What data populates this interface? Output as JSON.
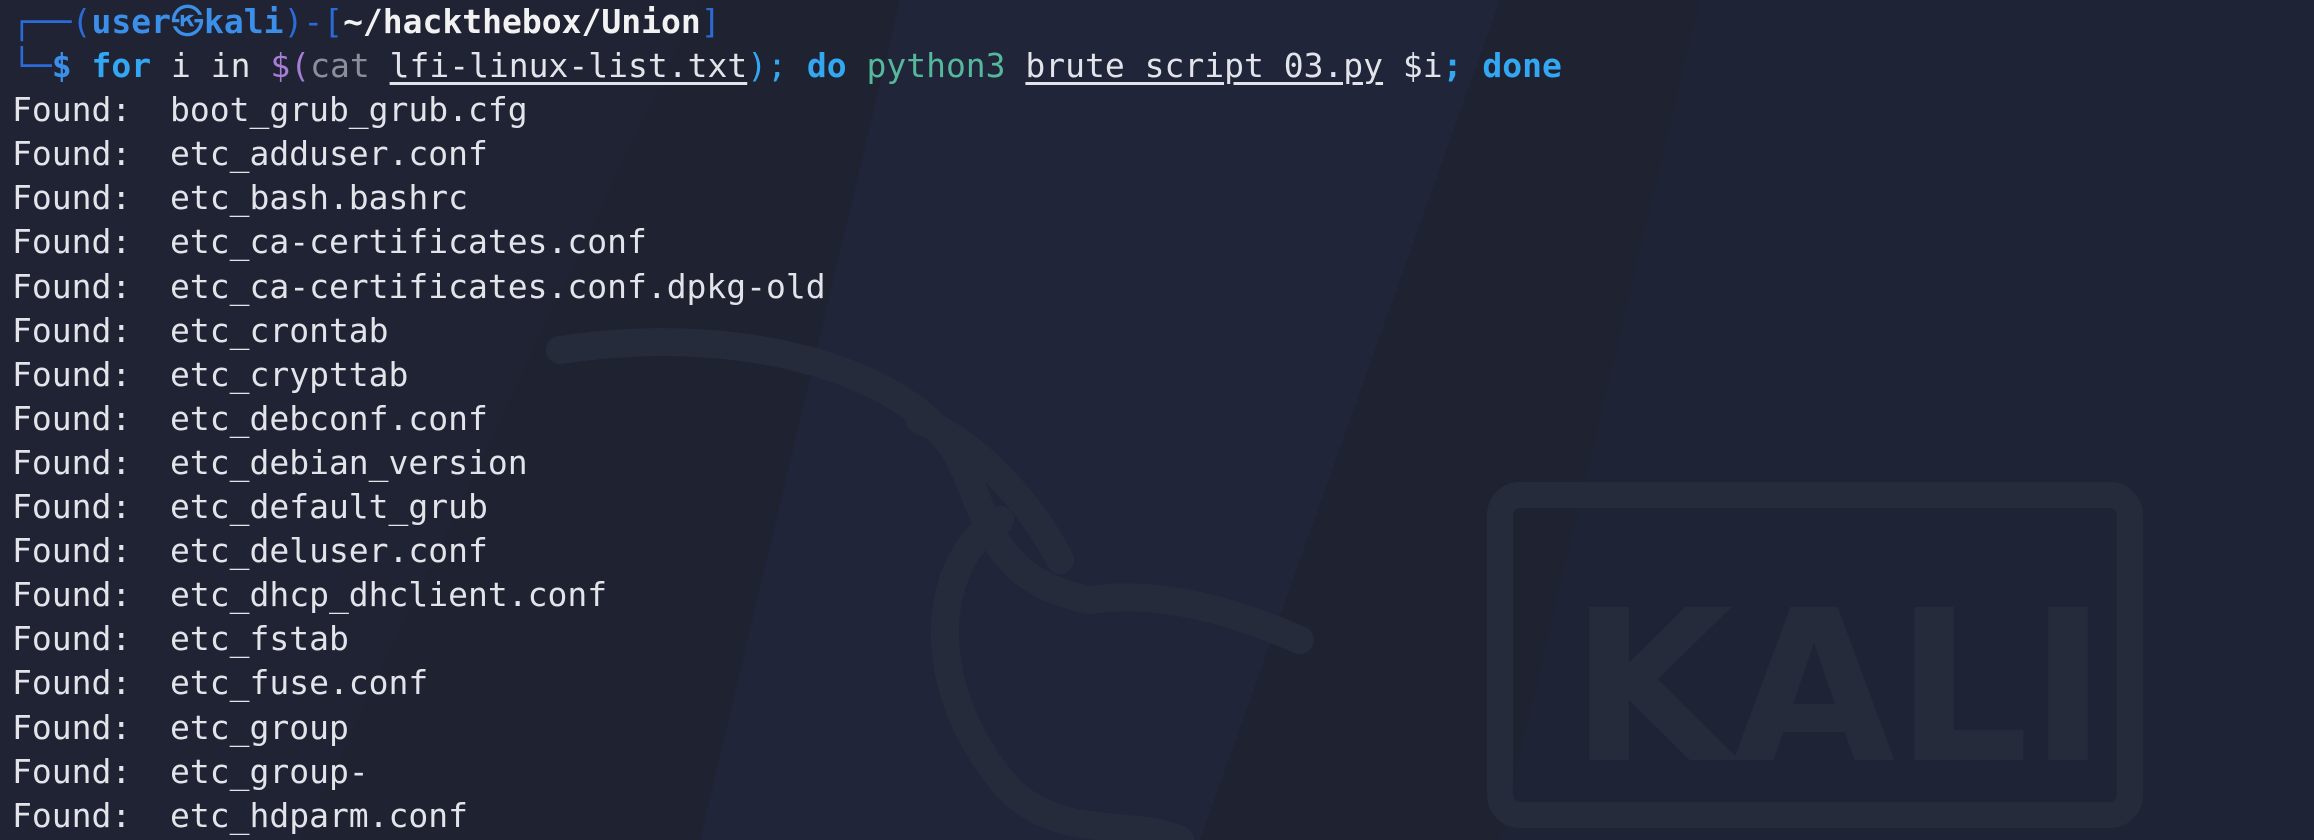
{
  "prompt": {
    "user": "user",
    "host_symbol": "㉿",
    "host": "kali",
    "cwd": "~/hackthebox/Union"
  },
  "command": {
    "dollar": "$",
    "kw_for": "for",
    "var": "i",
    "kw_in": "in",
    "subst_open": "$(",
    "cat": "cat",
    "file": "lfi-linux-list.txt",
    "subst_close": ");",
    "kw_do": "do",
    "interpreter": "python3",
    "script": "brute_script_03.py",
    "arg": "$i",
    "semicolon": ";",
    "kw_done": "done"
  },
  "output": {
    "label": "Found:",
    "files": [
      "boot_grub_grub.cfg",
      "etc_adduser.conf",
      "etc_bash.bashrc",
      "etc_ca-certificates.conf",
      "etc_ca-certificates.conf.dpkg-old",
      "etc_crontab",
      "etc_crypttab",
      "etc_debconf.conf",
      "etc_debian_version",
      "etc_default_grub",
      "etc_deluser.conf",
      "etc_dhcp_dhclient.conf",
      "etc_fstab",
      "etc_fuse.conf",
      "etc_group",
      "etc_group-",
      "etc_hdparm.conf"
    ]
  },
  "wallpaper": {
    "logo_text": "KALI"
  },
  "colors": {
    "background": "#1e2231",
    "prompt_blue": "#3b8fe8",
    "keyword_blue": "#33a7f2",
    "python_green": "#55b79b",
    "dollar_purple": "#a77dd6",
    "text": "#e2e4ea"
  }
}
